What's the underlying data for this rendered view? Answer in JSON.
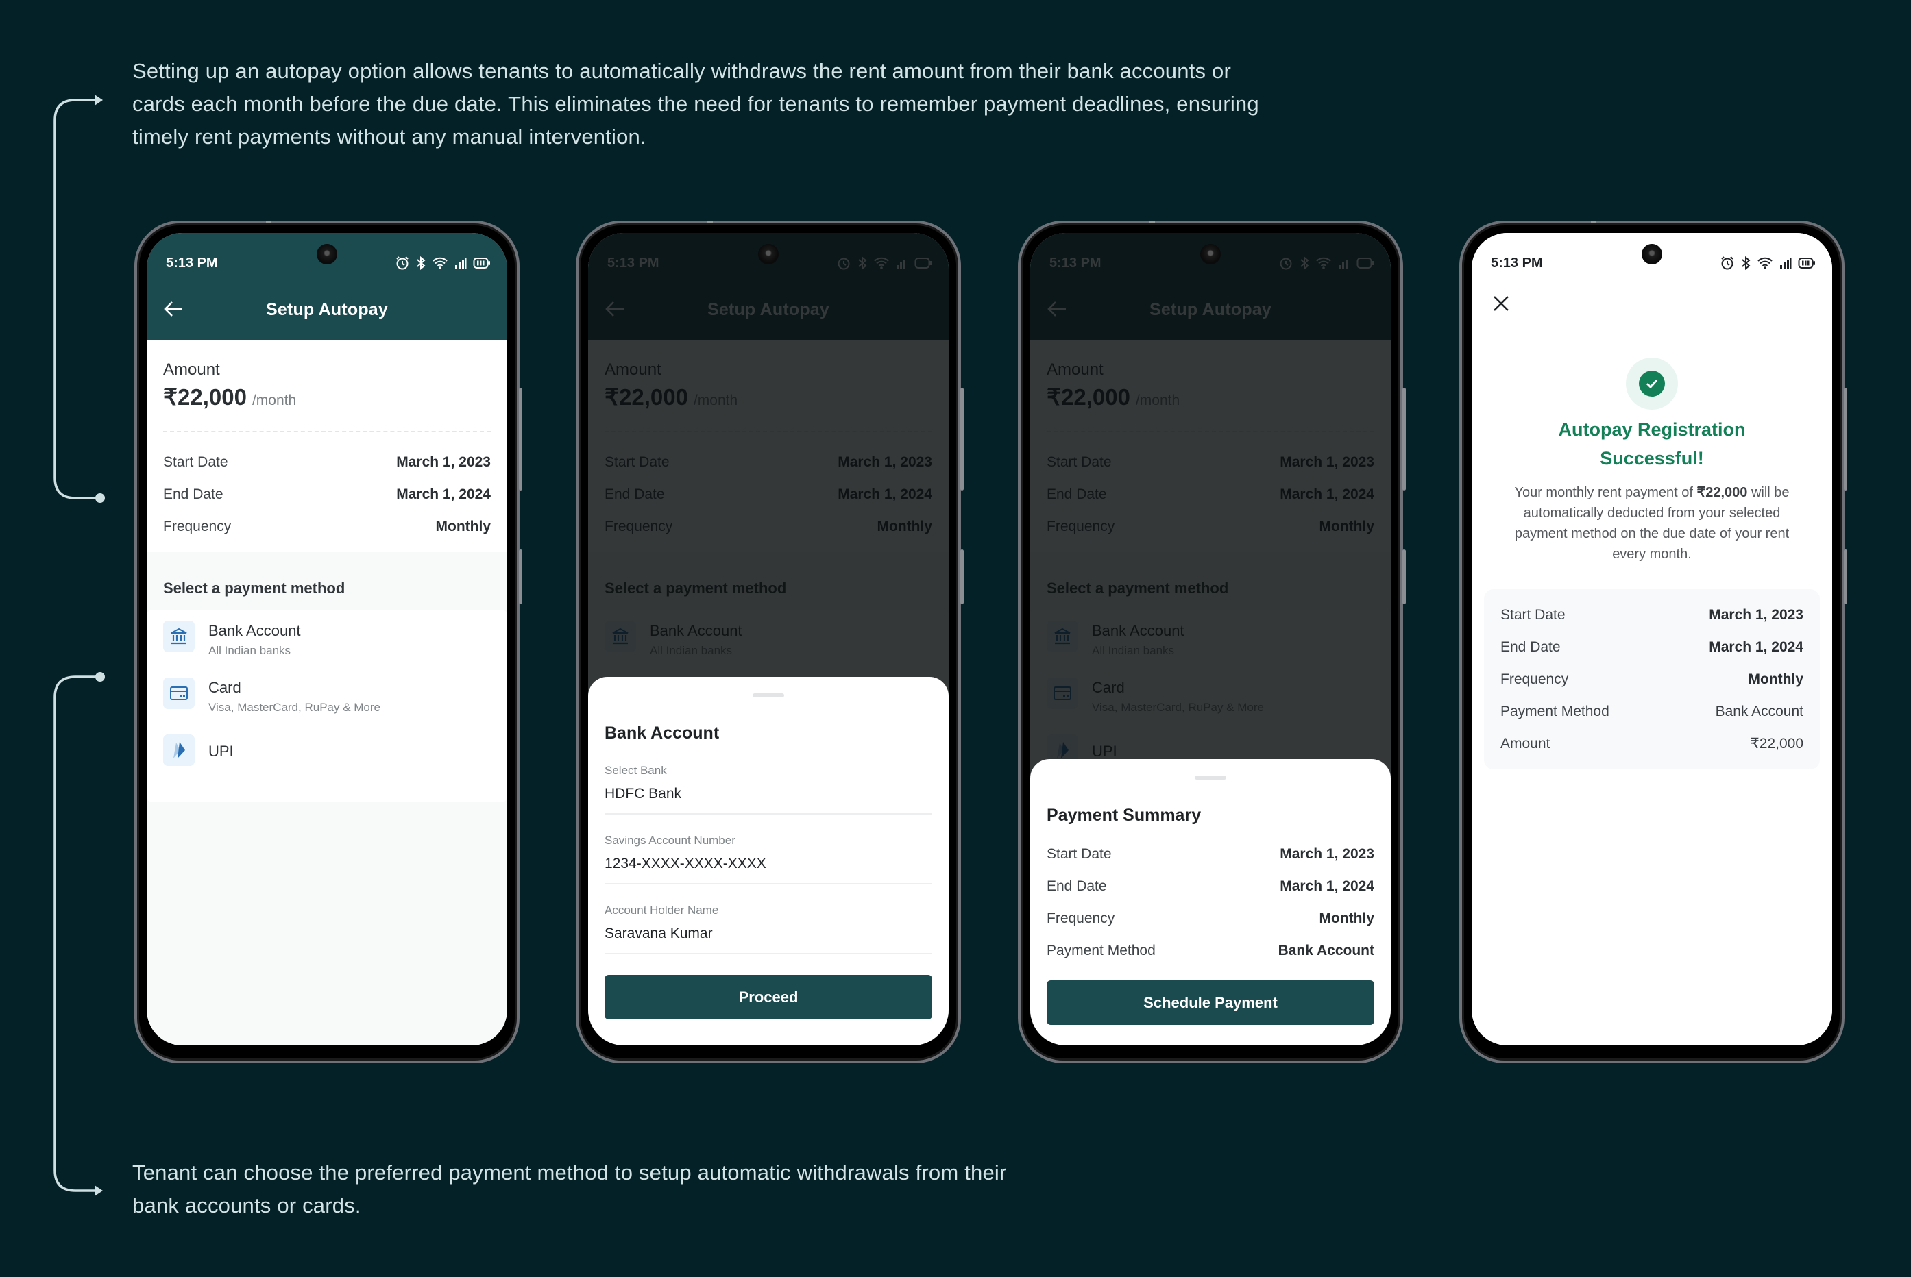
{
  "annotations": {
    "top": "Setting up an autopay option allows tenants to automatically withdraws the rent amount from their bank accounts or cards each month before the due date. This eliminates the need for tenants to remember payment deadlines, ensuring timely rent payments without any manual intervention.",
    "bottom": "Tenant can choose the preferred payment method to setup automatic withdrawals from their bank accounts or cards."
  },
  "colors": {
    "background": "#032127",
    "brand": "#1b4a4f",
    "success": "#138057",
    "icon_blue": "#2a6fb3"
  },
  "status_bar": {
    "time": "5:13 PM",
    "icons": [
      "alarm-icon",
      "bluetooth-icon",
      "wifi-icon",
      "signal-icon",
      "battery-icon"
    ]
  },
  "setup": {
    "title": "Setup Autopay",
    "amount_label": "Amount",
    "amount_value": "₹22,000",
    "amount_unit": "/month",
    "details": [
      {
        "label": "Start Date",
        "value": "March 1, 2023"
      },
      {
        "label": "End Date",
        "value": "March 1, 2024"
      },
      {
        "label": "Frequency",
        "value": "Monthly"
      }
    ],
    "methods_title": "Select a payment method",
    "methods": [
      {
        "icon": "bank-icon",
        "title": "Bank Account",
        "subtitle": "All Indian banks"
      },
      {
        "icon": "card-icon",
        "title": "Card",
        "subtitle": "Visa, MasterCard, RuPay & More"
      },
      {
        "icon": "upi-icon",
        "title": "UPI",
        "subtitle": ""
      }
    ]
  },
  "bank_sheet": {
    "title": "Bank Account",
    "fields": [
      {
        "label": "Select Bank",
        "value": "HDFC Bank"
      },
      {
        "label": "Savings Account Number",
        "value": "1234-XXXX-XXXX-XXXX"
      },
      {
        "label": "Account Holder Name",
        "value": "Saravana Kumar"
      }
    ],
    "button": "Proceed"
  },
  "summary_sheet": {
    "title": "Payment Summary",
    "rows": [
      {
        "label": "Start Date",
        "value": "March 1, 2023"
      },
      {
        "label": "End Date",
        "value": "March 1, 2024"
      },
      {
        "label": "Frequency",
        "value": "Monthly"
      },
      {
        "label": "Payment Method",
        "value": "Bank Account"
      }
    ],
    "button": "Schedule Payment"
  },
  "success": {
    "title_line1": "Autopay Registration",
    "title_line2": "Successful!",
    "desc_before": "Your monthly rent payment of ",
    "desc_amount": "₹22,000",
    "desc_after": " will be automatically deducted from your selected payment method on the due date of your rent every month.",
    "rows": [
      {
        "label": "Start Date",
        "value": "March 1, 2023"
      },
      {
        "label": "End Date",
        "value": "March 1, 2024"
      },
      {
        "label": "Frequency",
        "value": "Monthly"
      },
      {
        "label": "Payment Method",
        "value": "Bank Account"
      },
      {
        "label": "Amount",
        "value": "₹22,000"
      }
    ]
  }
}
